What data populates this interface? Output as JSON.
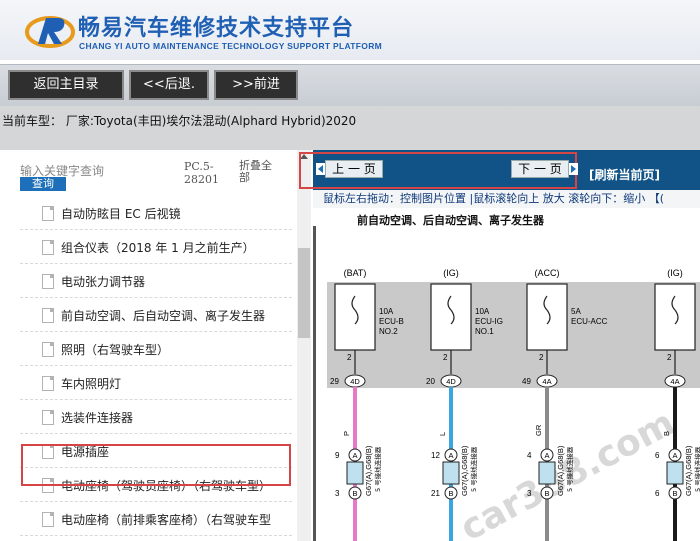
{
  "header": {
    "title_cn": "畅易汽车维修技术支持平台",
    "title_en": "CHANG YI AUTO MAINTENANCE TECHNOLOGY SUPPORT PLATFORM",
    "brand_color": "#1f5fb4"
  },
  "toolbar": {
    "home_label": "返回主目录",
    "back_label": "<<后退.",
    "forward_label": ">>前进"
  },
  "model_bar": {
    "text": "当前车型： 厂家:Toyota(丰田)埃尔法混动(Alphard Hybrid)2020"
  },
  "left_panel": {
    "search_hint": "输入关键字查询",
    "search_button": "查询",
    "pc_label": "PC.5-28201",
    "fold_label": "折叠全部",
    "items": [
      "自动防眩目 EC 后视镜",
      "组合仪表（2018 年 1 月之前生产）",
      "电动张力调节器",
      "前自动空调、后自动空调、离子发生器",
      "照明（右驾驶车型）",
      "车内照明灯",
      "选装件连接器",
      "电源插座",
      "电动座椅（驾驶员座椅）（右驾驶车型）",
      "电动座椅（前排乘客座椅）（右驾驶车型"
    ],
    "selected_index": 3
  },
  "right_panel": {
    "prev_label": "上 一 页",
    "next_label": "下 一 页",
    "refresh_label": "[刷新当前页]",
    "hint": "鼠标左右拖动：控制图片位置 |鼠标滚轮向上 放大  滚轮向下：缩小 【(",
    "diagram_title": "前自动空调、后自动空调、离子发生器",
    "fuses": [
      {
        "supply": "(BAT)",
        "rating": "10A",
        "name1": "ECU-B",
        "name2": "NO.2",
        "pin": "2",
        "conn_pin": "29",
        "conn": "4D",
        "wire": "P",
        "mid_top": "9",
        "mid_bot": "3",
        "mid_top_l": "A",
        "mid_bot_l": "B",
        "wire_color": "#e879c8"
      },
      {
        "supply": "(IG)",
        "rating": "10A",
        "name1": "ECU-IG",
        "name2": "NO.1",
        "pin": "2",
        "conn_pin": "20",
        "conn": "4D",
        "wire": "L",
        "mid_top": "12",
        "mid_bot": "21",
        "mid_top_l": "A",
        "mid_bot_l": "B",
        "wire_color": "#3aa7e0"
      },
      {
        "supply": "(ACC)",
        "rating": "5A",
        "name1": "ECU-ACC",
        "name2": "",
        "pin": "2",
        "conn_pin": "49",
        "conn": "4A",
        "wire": "GR",
        "mid_top": "4",
        "mid_bot": "3",
        "mid_top_l": "A",
        "mid_bot_l": "B",
        "wire_color": "#8b8b8b"
      },
      {
        "supply": "(IG)",
        "rating": "",
        "name1": "",
        "name2": "",
        "pin": "2",
        "conn_pin": "",
        "conn": "4A",
        "wire": "B",
        "mid_top": "6",
        "mid_bot": "6",
        "mid_top_l": "A",
        "mid_bot_l": "B",
        "wire_color": "#1a1a1a"
      }
    ],
    "connector_label": "G67(A),G68(B)",
    "connector_sub": "5 号接线连接器",
    "watermark": "car388.com"
  }
}
